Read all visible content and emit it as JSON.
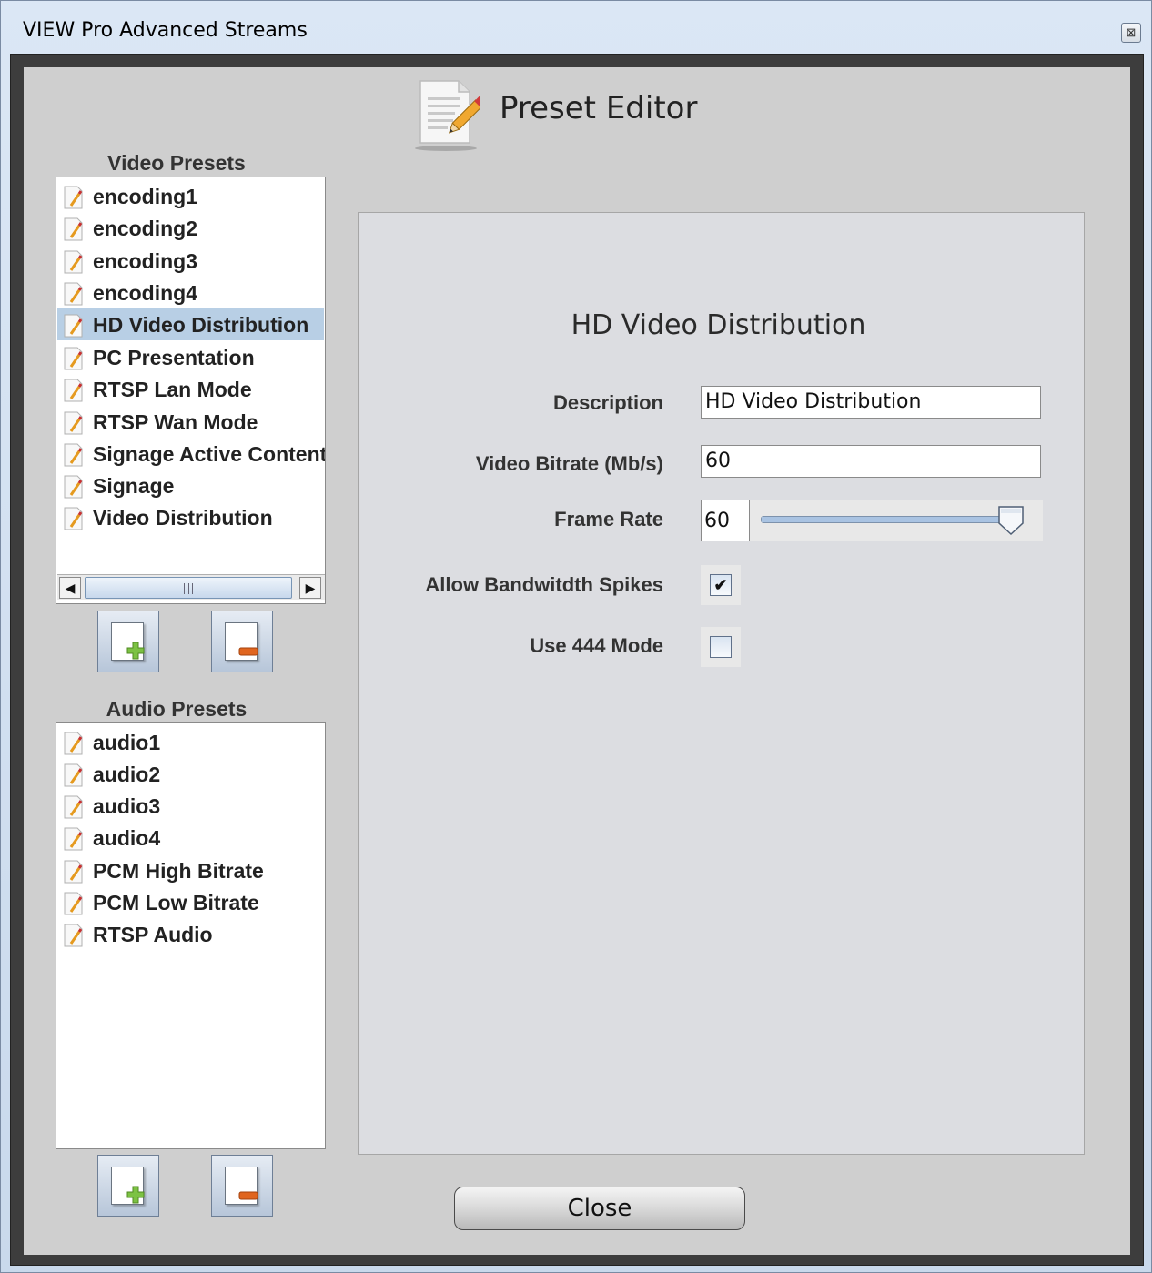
{
  "window": {
    "title": "VIEW Pro Advanced Streams",
    "close_glyph": "⊠"
  },
  "header": {
    "title": "Preset Editor",
    "icon": "document-edit-icon"
  },
  "video_presets": {
    "label": "Video Presets",
    "items": [
      {
        "label": "encoding1"
      },
      {
        "label": "encoding2"
      },
      {
        "label": "encoding3"
      },
      {
        "label": "encoding4"
      },
      {
        "label": "HD Video Distribution",
        "selected": true
      },
      {
        "label": "PC Presentation"
      },
      {
        "label": "RTSP Lan Mode"
      },
      {
        "label": "RTSP Wan Mode"
      },
      {
        "label": "Signage Active Content"
      },
      {
        "label": "Signage"
      },
      {
        "label": "Video Distribution"
      }
    ],
    "scroll_left": "◀",
    "scroll_right": "▶"
  },
  "audio_presets": {
    "label": "Audio Presets",
    "items": [
      {
        "label": "audio1"
      },
      {
        "label": "audio2"
      },
      {
        "label": "audio3"
      },
      {
        "label": "audio4"
      },
      {
        "label": "PCM High Bitrate"
      },
      {
        "label": "PCM Low Bitrate"
      },
      {
        "label": "RTSP Audio"
      }
    ]
  },
  "editor": {
    "title": "HD Video Distribution",
    "description_label": "Description",
    "description_value": "HD Video Distribution",
    "bitrate_label": "Video Bitrate (Mb/s)",
    "bitrate_value": "60",
    "framerate_label": "Frame Rate",
    "framerate_value": "60",
    "framerate_slider_fraction": 1.0,
    "spikes_label": "Allow Bandwitdth Spikes",
    "spikes_checked": true,
    "spikes_glyph": "✔",
    "mode444_label": "Use 444 Mode",
    "mode444_checked": false
  },
  "footer": {
    "close_label": "Close"
  },
  "colors": {
    "selection": "#b8cfe5",
    "add_accent": "#7cc243",
    "remove_accent": "#e0651f"
  }
}
